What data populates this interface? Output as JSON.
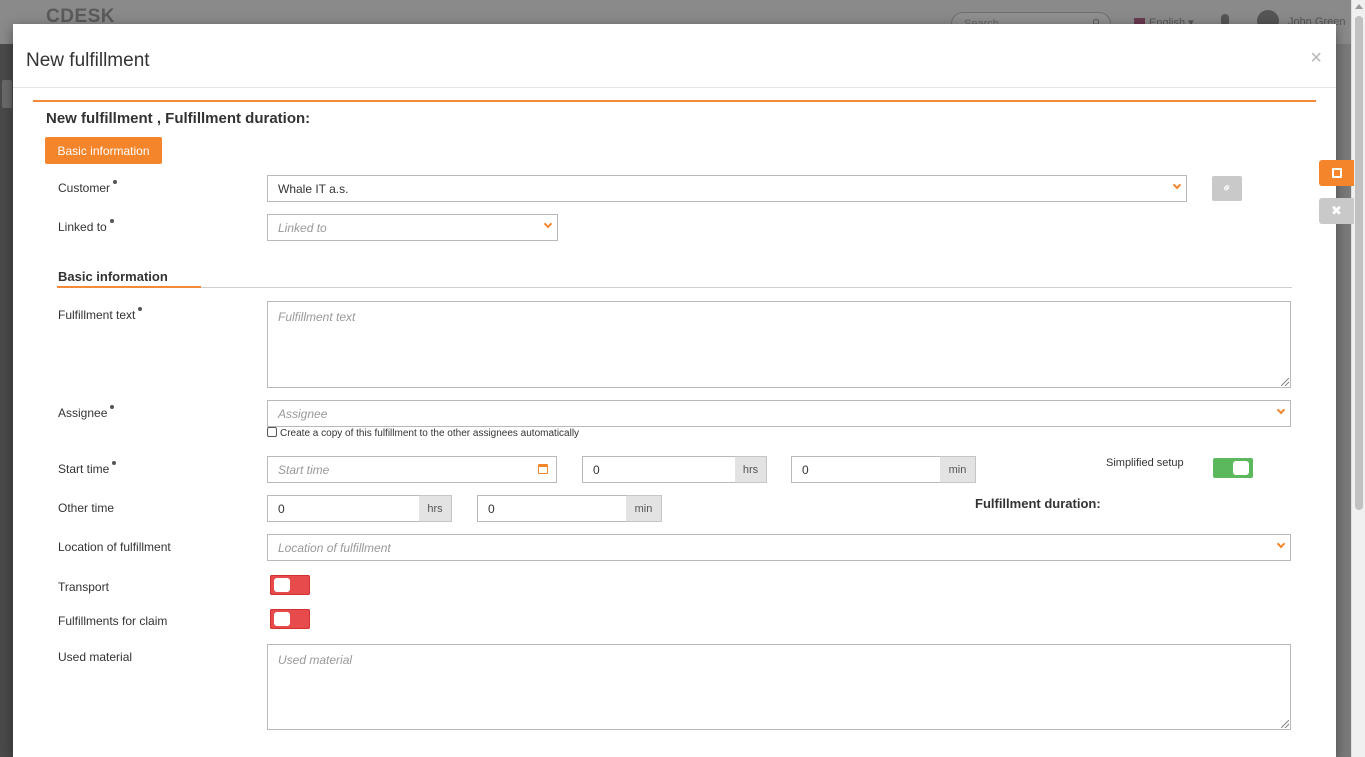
{
  "background": {
    "logo": "CDESK",
    "search_placeholder": "Search...",
    "language": "English",
    "user_name": "John Green"
  },
  "modal": {
    "title": "New fulfillment",
    "close_symbol": "×"
  },
  "form": {
    "heading": "New fulfillment , Fulfillment duration:",
    "tab_label": "Basic information",
    "customer": {
      "label": "Customer",
      "value": "Whale IT a.s."
    },
    "linked_to": {
      "label": "Linked to",
      "placeholder": "Linked to"
    },
    "section_title": "Basic information",
    "fulfillment_text": {
      "label": "Fulfillment text",
      "placeholder": "Fulfillment text"
    },
    "assignee": {
      "label": "Assignee",
      "placeholder": "Assignee"
    },
    "copy_checkbox": {
      "label": "Create a copy of this fulfillment to the other assignees automatically",
      "checked": false
    },
    "start_time": {
      "label": "Start time",
      "placeholder": "Start time",
      "hours": "0",
      "hours_unit": "hrs",
      "minutes": "0",
      "minutes_unit": "min"
    },
    "simplified_setup": {
      "label": "Simplified setup",
      "enabled": true
    },
    "other_time": {
      "label": "Other time",
      "hours": "0",
      "hours_unit": "hrs",
      "minutes": "0",
      "minutes_unit": "min"
    },
    "fulfillment_duration_label": "Fulfillment duration:",
    "location": {
      "label": "Location of fulfillment",
      "placeholder": "Location of fulfillment"
    },
    "transport": {
      "label": "Transport",
      "enabled": false
    },
    "claim": {
      "label": "Fulfillments for claim",
      "enabled": false
    },
    "used_material": {
      "label": "Used material",
      "placeholder": "Used material"
    }
  },
  "side_actions": {
    "save_icon": "floppy-disk-icon",
    "cancel_symbol": "✖"
  },
  "colors": {
    "accent": "#f5852b",
    "toggle_on": "#5cb85c",
    "toggle_off": "#e84b4b"
  }
}
